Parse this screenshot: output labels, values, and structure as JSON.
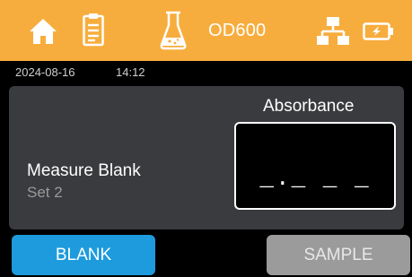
{
  "header": {
    "mode_label": "OD600",
    "icons": [
      "home-icon",
      "clipboard-icon",
      "flask-icon",
      "network-icon",
      "battery-icon"
    ],
    "background_color": "#f7ad3d"
  },
  "status": {
    "date": "2024-08-16",
    "time": "14:12"
  },
  "measure": {
    "title": "Measure Blank",
    "subtitle": "Set 2"
  },
  "absorbance": {
    "label": "Absorbance",
    "value": "_._ _ _"
  },
  "buttons": {
    "blank_label": "BLANK",
    "sample_label": "SAMPLE",
    "blank_color": "#1e9bdc",
    "sample_color": "#9b9b9b"
  }
}
